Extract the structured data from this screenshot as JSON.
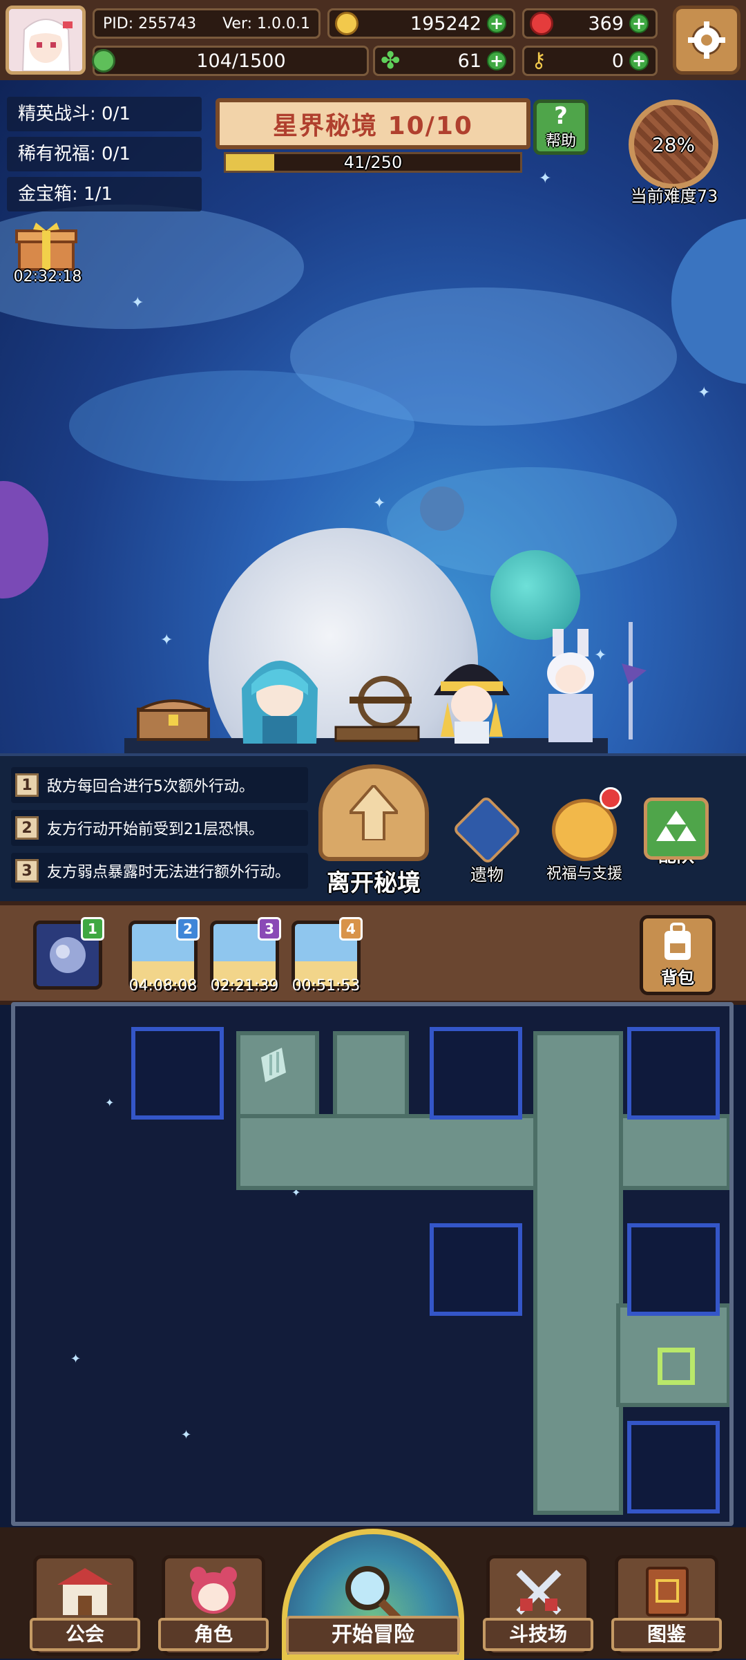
{
  "header": {
    "pid": "PID: 255743",
    "version": "Ver: 1.0.0.1",
    "gold": "195242",
    "gems": "369",
    "stamina": "104/1500",
    "clover": "61",
    "key": "0"
  },
  "quests": [
    {
      "label": "精英战斗: 0/1"
    },
    {
      "label": "稀有祝福: 0/1"
    },
    {
      "label": "金宝箱: 1/1"
    }
  ],
  "chest_timer": "02:32:18",
  "stage": {
    "title": "星界秘境 10/10",
    "progress_text": "41/250",
    "progress_value": 41,
    "progress_max": 250,
    "help_label": "帮助",
    "difficulty_percent": "28%",
    "difficulty_label": "当前难度73"
  },
  "effects": [
    {
      "num": "1",
      "text": "敌方每回合进行5次额外行动。"
    },
    {
      "num": "2",
      "text": "友方行动开始前受到21层恐惧。"
    },
    {
      "num": "3",
      "text": "友方弱点暴露时无法进行额外行动。"
    }
  ],
  "actions": {
    "leave": "离开秘境",
    "relics": "遗物",
    "blessing": "祝福与支援",
    "team": "配队"
  },
  "inventory": {
    "slots": [
      {
        "badge": "1",
        "timer": ""
      },
      {
        "badge": "2",
        "timer": "04:08:08"
      },
      {
        "badge": "3",
        "timer": "02:21:39"
      },
      {
        "badge": "4",
        "timer": "00:51:53"
      }
    ],
    "backpack": "背包"
  },
  "nav": {
    "guild": "公会",
    "character": "角色",
    "start": "开始冒险",
    "arena": "斗技场",
    "codex": "图鉴"
  },
  "colors": {
    "accent_gold": "#e6c44a",
    "title_red": "#b0402e",
    "plus_green": "#3fa842",
    "room_blue": "#3456c8"
  }
}
